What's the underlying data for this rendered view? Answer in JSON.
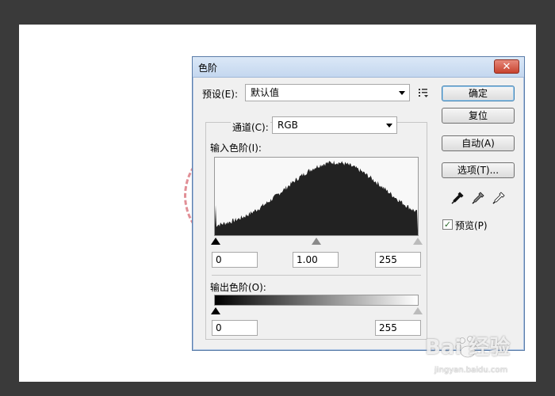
{
  "dialog": {
    "title": "色阶",
    "close_label": "✕"
  },
  "preset": {
    "label": "预设(E):",
    "value": "默认值"
  },
  "channel": {
    "label": "通道(C):",
    "value": "RGB"
  },
  "input_levels": {
    "label": "输入色阶(I):",
    "black": "0",
    "gamma": "1.00",
    "white": "255"
  },
  "output_levels": {
    "label": "输出色阶(O):",
    "black": "0",
    "white": "255"
  },
  "buttons": {
    "ok": "确定",
    "reset": "复位",
    "auto": "自动(A)",
    "options": "选项(T)..."
  },
  "preview": {
    "label": "预览(P)",
    "checked": true
  },
  "watermark": {
    "brand": "Bai 经验",
    "url": "jingyan.baidu.com"
  },
  "colors": {
    "accent": "#3c7fb1",
    "histogram": "#222222"
  },
  "icons": [
    "eyedropper-black-icon",
    "eyedropper-gray-icon",
    "eyedropper-white-icon",
    "preset-menu-icon",
    "close-icon"
  ]
}
